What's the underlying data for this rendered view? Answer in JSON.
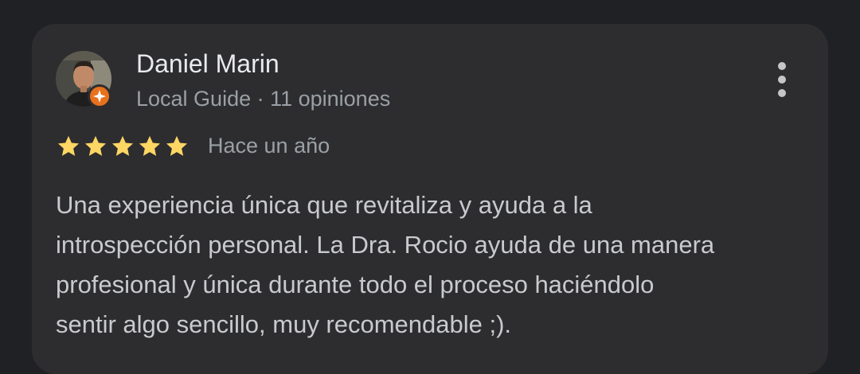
{
  "review": {
    "author_name": "Daniel Marin",
    "author_meta": "Local Guide · 11 opiniones",
    "rating": 5,
    "rating_max": 5,
    "date": "Hace un año",
    "text_lines": [
      "Una experiencia única que revitaliza y ayuda a la",
      "introspección personal. La Dra. Rocio ayuda de una manera",
      "profesional y única durante todo el proceso haciéndolo",
      "sentir algo sencillo, muy recomendable ;)."
    ]
  },
  "icons": {
    "avatar": "avatar",
    "badge": "local-guide-badge-icon",
    "star": "star-icon",
    "more": "more-vert-icon"
  },
  "colors": {
    "background": "#202124",
    "card": "#2d2d2f",
    "star": "#fdd663",
    "badge": "#e8711c"
  }
}
